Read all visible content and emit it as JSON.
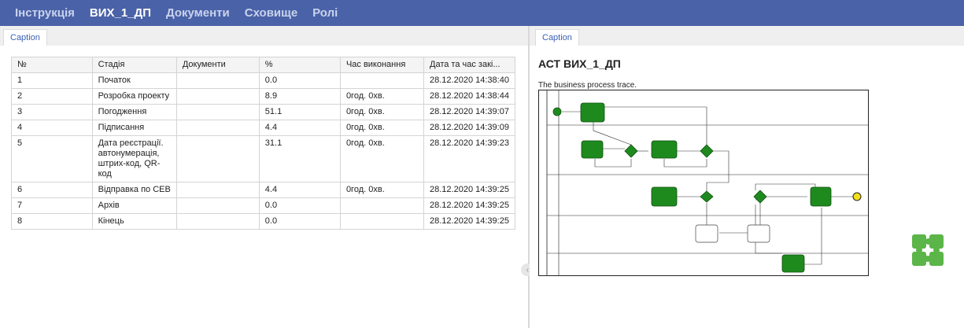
{
  "nav": {
    "items": [
      {
        "label": "Інструкція",
        "active": false
      },
      {
        "label": "ВИХ_1_ДП",
        "active": true
      },
      {
        "label": "Документи",
        "active": false
      },
      {
        "label": "Сховище",
        "active": false
      },
      {
        "label": "Ролі",
        "active": false
      }
    ]
  },
  "left": {
    "tab_label": "Caption",
    "table": {
      "headers": [
        "№",
        "Стадія",
        "Документи",
        "%",
        "Час виконання",
        "Дата та час закі..."
      ],
      "rows": [
        [
          "1",
          "Початок",
          "",
          "0.0",
          "",
          "28.12.2020 14:38:40"
        ],
        [
          "2",
          "Розробка проекту",
          "",
          "8.9",
          "0год. 0хв.",
          "28.12.2020 14:38:44"
        ],
        [
          "3",
          "Погодження",
          "",
          "51.1",
          "0год. 0хв.",
          "28.12.2020 14:39:07"
        ],
        [
          "4",
          "Підписання",
          "",
          "4.4",
          "0год. 0хв.",
          "28.12.2020 14:39:09"
        ],
        [
          "5",
          "Дата реєстрації. автонумерація, штрих-код, QR-код",
          "",
          "31.1",
          "0год. 0хв.",
          "28.12.2020 14:39:23"
        ],
        [
          "6",
          "Відправка по СЕВ",
          "",
          "4.4",
          "0год. 0хв.",
          "28.12.2020 14:39:25"
        ],
        [
          "7",
          "Архів",
          "",
          "0.0",
          "",
          "28.12.2020 14:39:25"
        ],
        [
          "8",
          "Кінець",
          "",
          "0.0",
          "",
          "28.12.2020 14:39:25"
        ]
      ]
    }
  },
  "right": {
    "tab_label": "Caption",
    "title": "АСТ ВИХ_1_ДП",
    "caption": "The business process trace."
  },
  "colors": {
    "nav_bg": "#4a62a7",
    "task_green": "#1e8a1e",
    "end_event": "#f2e01a",
    "logo_green": "#5cb548"
  }
}
